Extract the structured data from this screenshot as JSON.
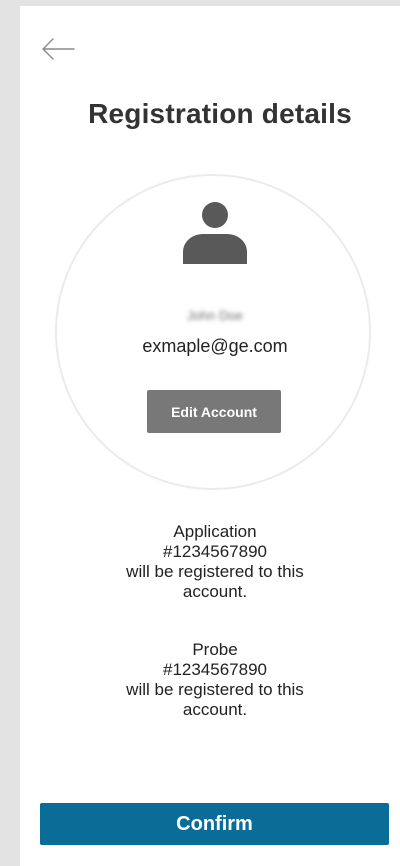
{
  "header": {
    "back_icon": "arrow-left-icon",
    "title": "Registration details"
  },
  "account": {
    "avatar_icon": "user-icon",
    "name": "John Doe",
    "email": "exmaple@ge.com",
    "edit_label": "Edit Account"
  },
  "registration": {
    "application": {
      "label": "Application",
      "number": "#1234567890",
      "line_1": "will be registered to this",
      "line_2": "account."
    },
    "probe": {
      "label": "Probe",
      "number": "#1234567890",
      "line_1": "will be registered to this",
      "line_2": "account."
    }
  },
  "footer": {
    "confirm_label": "Confirm"
  },
  "colors": {
    "primary_button": "#0a6d98",
    "secondary_button": "#787878",
    "text": "#222222",
    "title": "#333333",
    "avatar": "#595959"
  }
}
